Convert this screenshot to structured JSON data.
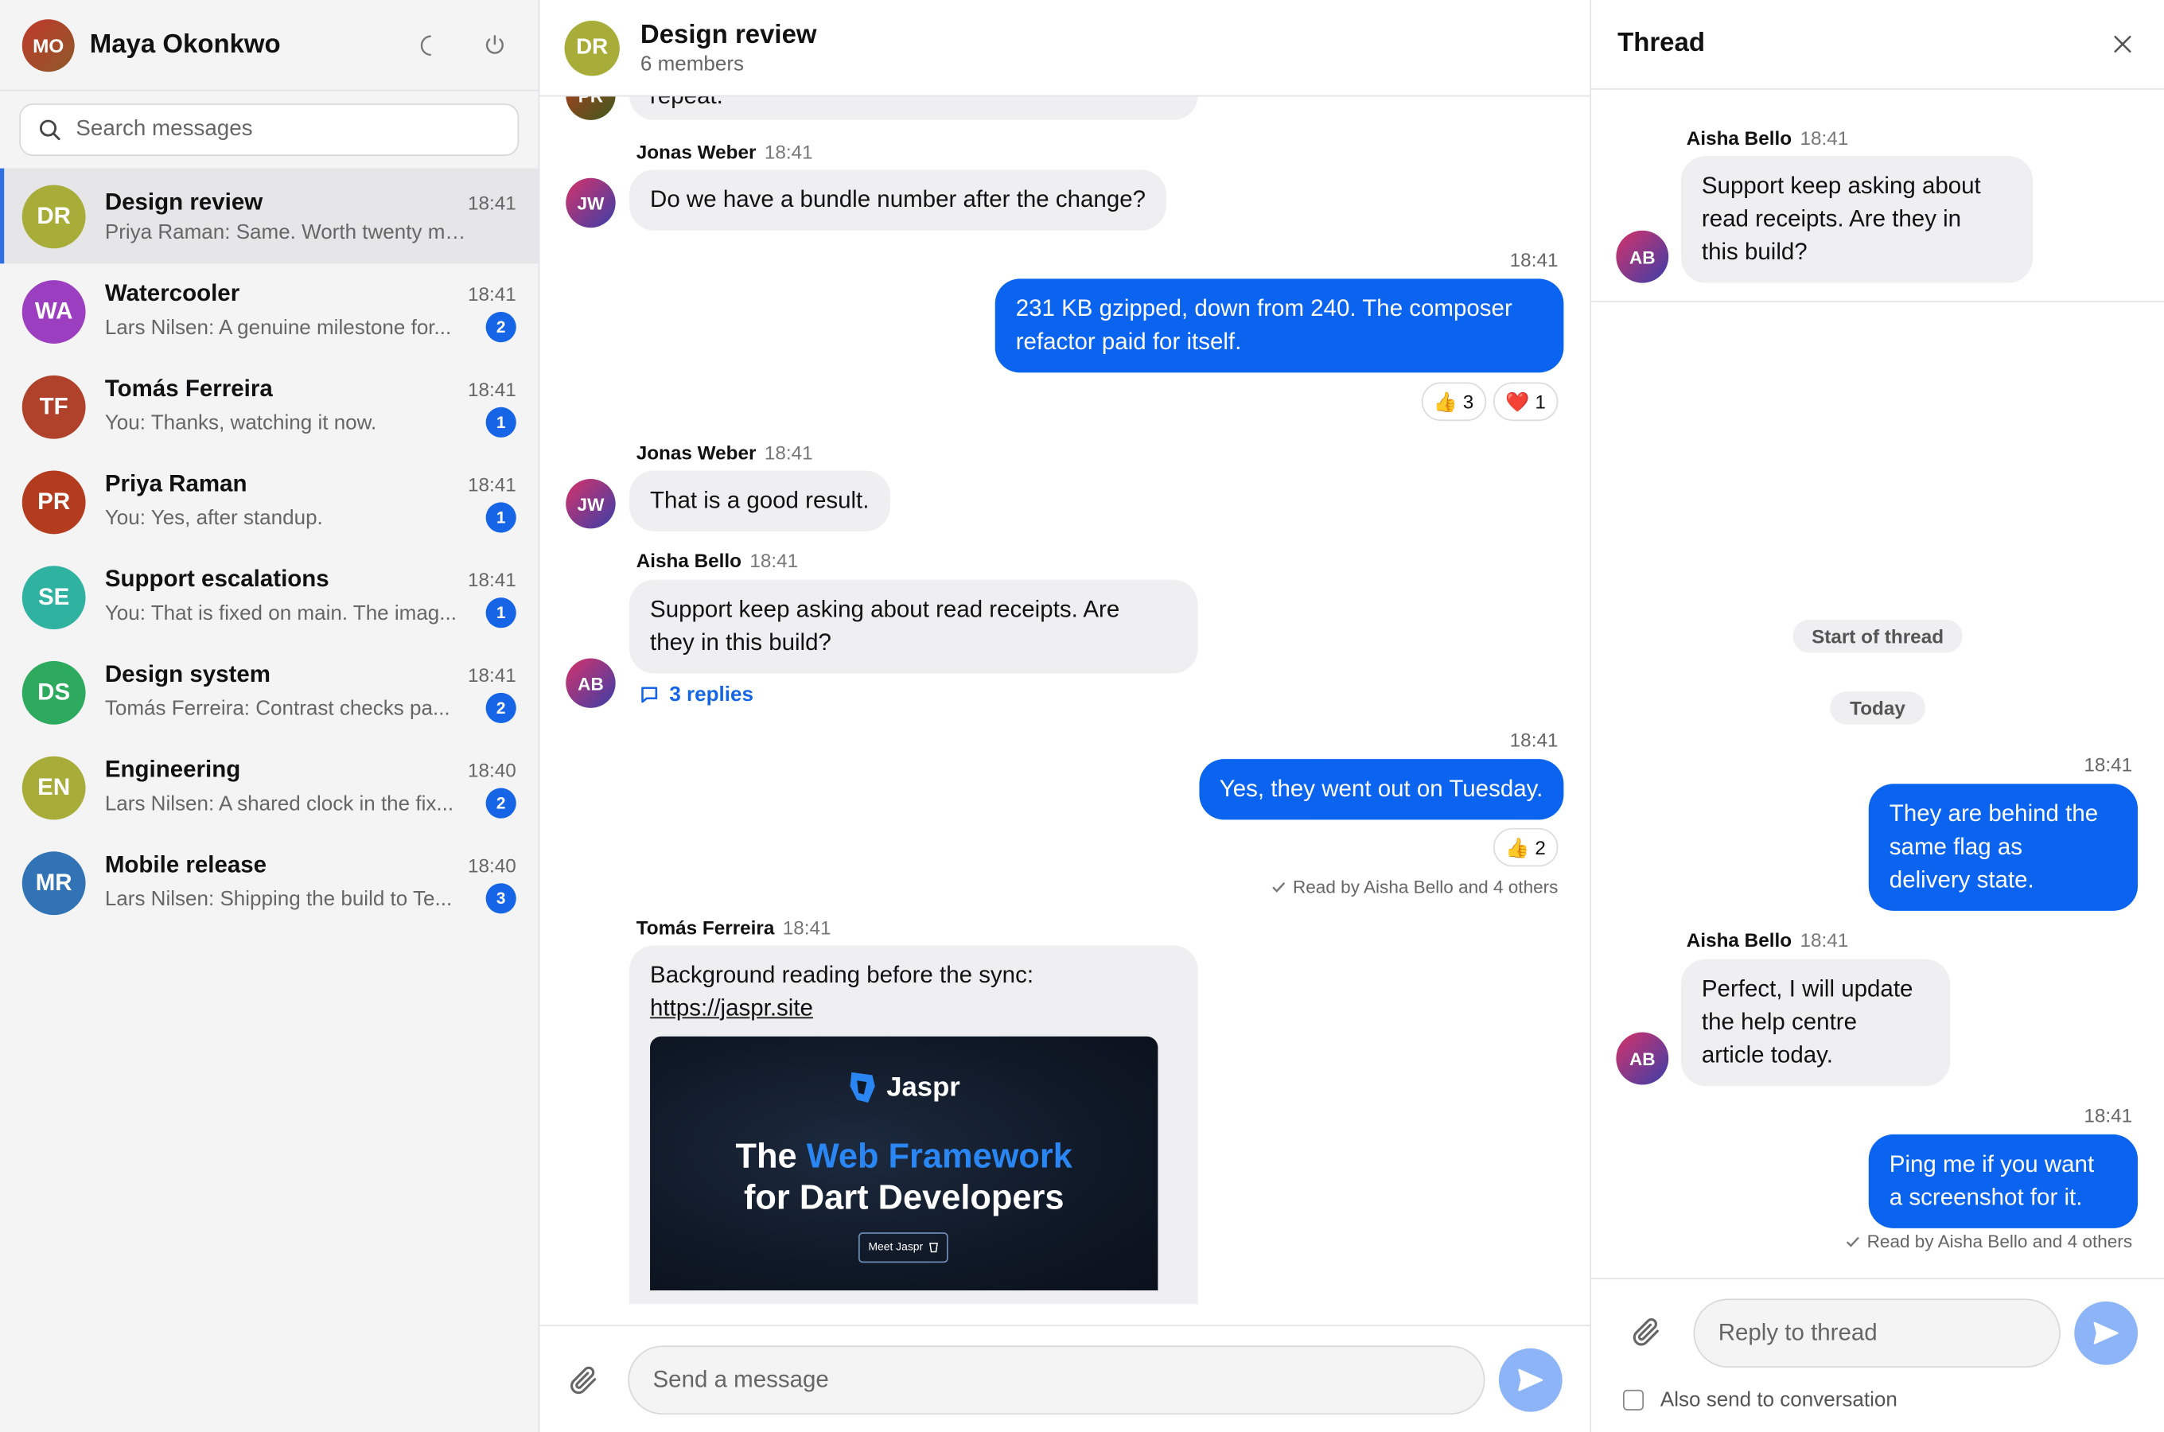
{
  "user": {
    "name": "Maya Okonkwo",
    "initials": "MO",
    "avatar_gradient": [
      "#c0392b",
      "#8e5a2a"
    ]
  },
  "search": {
    "placeholder": "Search messages"
  },
  "conversations": [
    {
      "initials": "DR",
      "title": "Design review",
      "time": "18:41",
      "preview": "Priya Raman: Same. Worth twenty minut...",
      "badge": "",
      "color": "#a8ad3a",
      "active": true
    },
    {
      "initials": "WA",
      "title": "Watercooler",
      "time": "18:41",
      "preview": "Lars Nilsen: A genuine milestone for...",
      "badge": "2",
      "color": "#9b3ebf"
    },
    {
      "initials": "TF",
      "title": "Tomás Ferreira",
      "time": "18:41",
      "preview": "You: Thanks, watching it now.",
      "badge": "1",
      "color": "#b0412a"
    },
    {
      "initials": "PR",
      "title": "Priya Raman",
      "time": "18:41",
      "preview": "You: Yes, after standup.",
      "badge": "1",
      "color": "#b33c1e"
    },
    {
      "initials": "SE",
      "title": "Support escalations",
      "time": "18:41",
      "preview": "You: That is fixed on main. The imag...",
      "badge": "1",
      "color": "#2fb3a0"
    },
    {
      "initials": "DS",
      "title": "Design system",
      "time": "18:41",
      "preview": "Tomás Ferreira: Contrast checks pa...",
      "badge": "2",
      "color": "#2eaa5e"
    },
    {
      "initials": "EN",
      "title": "Engineering",
      "time": "18:40",
      "preview": "Lars Nilsen: A shared clock in the fix...",
      "badge": "2",
      "color": "#a8ad3a"
    },
    {
      "initials": "MR",
      "title": "Mobile release",
      "time": "18:40",
      "preview": "Lars Nilsen: Shipping the build to Te...",
      "badge": "3",
      "color": "#3273b5"
    }
  ],
  "chat": {
    "initials": "DR",
    "title": "Design review",
    "subtitle": "6 members",
    "partial_text": "repeat.",
    "partial_initials": "PR",
    "m1": {
      "sender": "Jonas Weber",
      "time": "18:41",
      "initials": "JW",
      "text": "Do we have a bundle number after the change?"
    },
    "m2": {
      "time": "18:41",
      "line1": "231 KB gzipped, down from 240. The composer",
      "line2": "refactor paid for itself.",
      "reactions": [
        {
          "emoji": "👍",
          "count": "3"
        },
        {
          "emoji": "❤️",
          "count": "1"
        }
      ]
    },
    "m3": {
      "sender": "Jonas Weber",
      "time": "18:41",
      "initials": "JW",
      "text": "That is a good result."
    },
    "m4": {
      "sender": "Aisha Bello",
      "time": "18:41",
      "initials": "AB",
      "line1": "Support keep asking about read receipts. Are",
      "line2": "they in this build?",
      "replies": "3 replies"
    },
    "m5": {
      "time": "18:41",
      "text": "Yes, they went out on Tuesday.",
      "reactions": [
        {
          "emoji": "👍",
          "count": "2"
        }
      ],
      "read_by": "Read by Aisha Bello and 4 others"
    },
    "m6": {
      "sender": "Tomás Ferreira",
      "time": "18:41",
      "text": "Background reading before the sync:",
      "link": "https://jaspr.site",
      "preview": {
        "logo": "Jaspr",
        "h_pre": "The ",
        "h_highlight": "Web Framework",
        "h_line2": "for Dart Developers",
        "button": "Meet Jaspr"
      }
    },
    "composer_placeholder": "Send a message"
  },
  "thread": {
    "title": "Thread",
    "parent": {
      "sender": "Aisha Bello",
      "time": "18:41",
      "initials": "AB",
      "lines": [
        "Support keep asking about",
        "read receipts. Are they in",
        "this build?"
      ]
    },
    "start_label": "Start of thread",
    "date_label": "Today",
    "t1": {
      "time": "18:41",
      "lines": [
        "They are behind the",
        "same flag as",
        "delivery state."
      ]
    },
    "t2": {
      "sender": "Aisha Bello",
      "time": "18:41",
      "initials": "AB",
      "lines": [
        "Perfect, I will update",
        "the help centre",
        "article today."
      ]
    },
    "t3": {
      "time": "18:41",
      "lines": [
        "Ping me if you want",
        "a screenshot for it."
      ],
      "read_by": "Read by Aisha Bello and 4 others"
    },
    "reply_placeholder": "Reply to thread",
    "also_send": "Also send to conversation"
  },
  "colors": {
    "accent": "#0a64f0",
    "badge": "#1565e6",
    "avatar_gradient_other": [
      "#d6326a",
      "#3a3fa8"
    ]
  }
}
